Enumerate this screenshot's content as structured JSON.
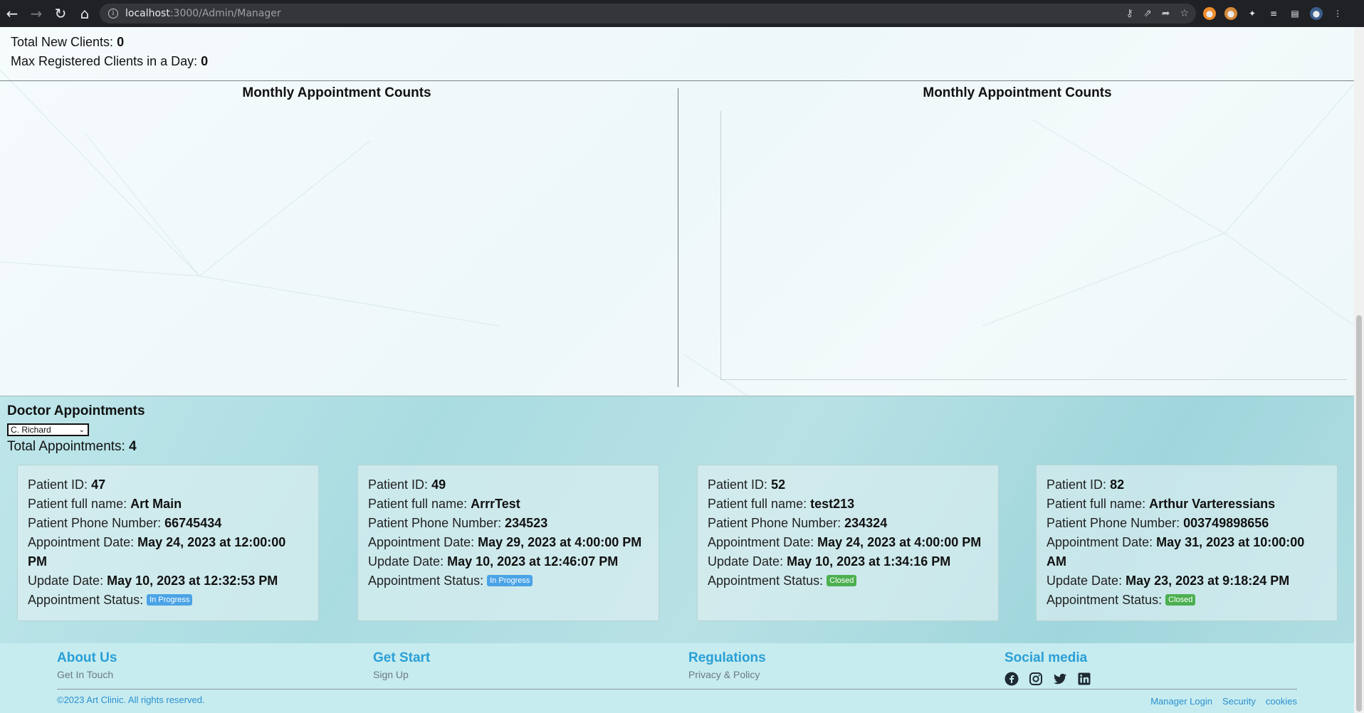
{
  "browser": {
    "url_host": "localhost",
    "url_path": ":3000/Admin/Manager"
  },
  "stats": {
    "new_clients_label": "Total New Clients:",
    "new_clients_value": "0",
    "max_registered_label": "Max Registered Clients in a Day:",
    "max_registered_value": "0"
  },
  "charts": {
    "left_title": "Monthly Appointment Counts",
    "right_title": "Monthly Appointment Counts"
  },
  "appointments": {
    "title": "Doctor Appointments",
    "selected_doctor": "C. Richard",
    "total_label": "Total Appointments:",
    "total_value": "4",
    "labels": {
      "patient_id": "Patient ID:",
      "full_name": "Patient full name:",
      "phone": "Patient Phone Number:",
      "appt_date": "Appointment Date:",
      "update_date": "Update Date:",
      "status": "Appointment Status:"
    },
    "cards": [
      {
        "patient_id": "47",
        "full_name": "Art Main",
        "phone": "66745434",
        "appt_date": "May 24, 2023 at 12:00:00 PM",
        "update_date": "May 10, 2023 at 12:32:53 PM",
        "status": "In Progress"
      },
      {
        "patient_id": "49",
        "full_name": "ArrrTest",
        "phone": "234523",
        "appt_date": "May 29, 2023 at 4:00:00 PM",
        "update_date": "May 10, 2023 at 12:46:07 PM",
        "status": "In Progress"
      },
      {
        "patient_id": "52",
        "full_name": "test213",
        "phone": "234324",
        "appt_date": "May 24, 2023 at 4:00:00 PM",
        "update_date": "May 10, 2023 at 1:34:16 PM",
        "status": "Closed"
      },
      {
        "patient_id": "82",
        "full_name": "Arthur Varteressians",
        "phone": "003749898656",
        "appt_date": "May 31, 2023 at 10:00:00 AM",
        "update_date": "May 23, 2023 at 9:18:24 PM",
        "status": "Closed"
      }
    ]
  },
  "footer": {
    "about_title": "About Us",
    "about_link": "Get In Touch",
    "start_title": "Get Start",
    "start_link": "Sign Up",
    "regulations_title": "Regulations",
    "regulations_link": "Privacy & Policy",
    "social_title": "Social media",
    "social_icons": [
      "facebook-icon",
      "instagram-icon",
      "twitter-icon",
      "linkedin-icon"
    ],
    "copyright": "©2023 Art Clinic. All rights reserved.",
    "bottom_links": [
      "Manager Login",
      "Security",
      "cookies"
    ]
  },
  "colors": {
    "accent": "#2a9fd6",
    "in_progress": "#4aa3e6",
    "closed": "#4caf50"
  }
}
